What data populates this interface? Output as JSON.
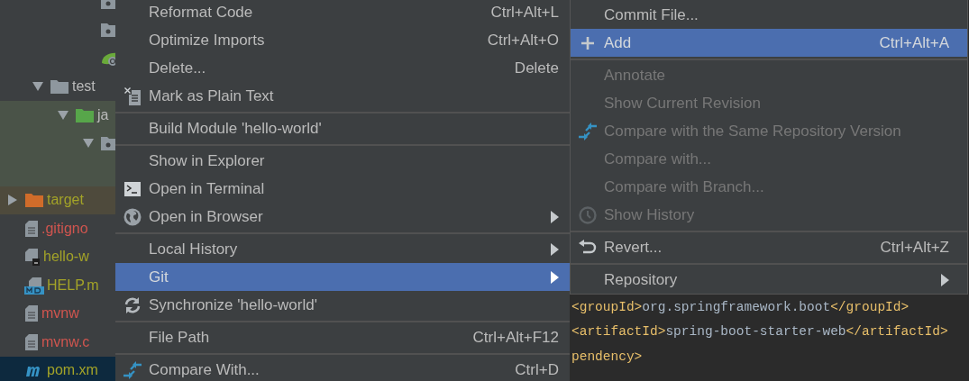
{
  "project_tree": {
    "continued_items": [
      {
        "kind": "package",
        "selected": false
      },
      {
        "kind": "package",
        "selected": false
      },
      {
        "kind": "spring-boot",
        "selected": false
      }
    ],
    "src_items": [
      {
        "kind": "folder",
        "label": "test",
        "color": "#bbbbbb",
        "expanded": true,
        "selected": false,
        "children": [
          {
            "kind": "source-folder",
            "label": "ja",
            "color": "#bbbbbb",
            "expanded": true,
            "selected": false,
            "children": [
              {
                "kind": "package",
                "expanded": true,
                "selected": false
              }
            ]
          }
        ]
      }
    ],
    "items": [
      {
        "kind": "excluded-folder",
        "label": "target",
        "color": "#a3a328",
        "expanded": false,
        "selected": false
      },
      {
        "kind": "text-file",
        "label": ".gitigno",
        "color": "#d0554f",
        "selected": false
      },
      {
        "kind": "script-file",
        "label": "hello-w",
        "color": "#a3a328",
        "selected": false
      },
      {
        "kind": "markdown-file",
        "label": "HELP.m",
        "color": "#a3a328",
        "selected": false
      },
      {
        "kind": "text-file",
        "label": "mvnw",
        "color": "#d0554f",
        "selected": false
      },
      {
        "kind": "text-file",
        "label": "mvnw.c",
        "color": "#d0554f",
        "selected": false
      },
      {
        "kind": "maven-file",
        "label": "pom.xm",
        "color": "#a3a328",
        "selected": true
      }
    ]
  },
  "context_menu": {
    "items": [
      {
        "kind": "item",
        "label": "Reformat Code",
        "shortcut": "Ctrl+Alt+L",
        "selected": false
      },
      {
        "kind": "item",
        "label": "Optimize Imports",
        "shortcut": "Ctrl+Alt+O",
        "selected": false
      },
      {
        "kind": "item",
        "label": "Delete...",
        "shortcut": "Delete",
        "selected": false
      },
      {
        "kind": "plaintext",
        "label": "Mark as Plain Text",
        "selected": false
      },
      {
        "kind": "separator"
      },
      {
        "kind": "item",
        "label": "Build Module 'hello-world'",
        "selected": false
      },
      {
        "kind": "separator"
      },
      {
        "kind": "item",
        "label": "Show in Explorer",
        "selected": false
      },
      {
        "kind": "terminal",
        "label": "Open in Terminal",
        "selected": false
      },
      {
        "kind": "globe",
        "label": "Open in Browser",
        "submenu": true,
        "selected": false
      },
      {
        "kind": "separator"
      },
      {
        "kind": "item",
        "label": "Local History",
        "submenu": true,
        "selected": false
      },
      {
        "kind": "item",
        "label": "Git",
        "submenu": true,
        "selected": true
      },
      {
        "kind": "sync",
        "label": "Synchronize 'hello-world'",
        "selected": false
      },
      {
        "kind": "separator"
      },
      {
        "kind": "item",
        "label": "File Path",
        "shortcut": "Ctrl+Alt+F12",
        "selected": false
      },
      {
        "kind": "separator"
      },
      {
        "kind": "compare",
        "label": "Compare With...",
        "shortcut": "Ctrl+D",
        "selected": false
      }
    ]
  },
  "git_submenu": {
    "items": [
      {
        "kind": "item",
        "label": "Commit File...",
        "disabled": false,
        "selected": false
      },
      {
        "kind": "plus",
        "label": "Add",
        "shortcut": "Ctrl+Alt+A",
        "disabled": false,
        "selected": true
      },
      {
        "kind": "separator"
      },
      {
        "kind": "item",
        "label": "Annotate",
        "disabled": true,
        "selected": false
      },
      {
        "kind": "item",
        "label": "Show Current Revision",
        "disabled": true,
        "selected": false
      },
      {
        "kind": "compare",
        "label": "Compare with the Same Repository Version",
        "disabled": true,
        "selected": false
      },
      {
        "kind": "item",
        "label": "Compare with...",
        "disabled": true,
        "selected": false
      },
      {
        "kind": "item",
        "label": "Compare with Branch...",
        "disabled": true,
        "selected": false
      },
      {
        "kind": "clock",
        "label": "Show History",
        "disabled": true,
        "selected": false
      },
      {
        "kind": "separator"
      },
      {
        "kind": "revert",
        "label": "Revert...",
        "shortcut": "Ctrl+Alt+Z",
        "disabled": false,
        "selected": false
      },
      {
        "kind": "separator"
      },
      {
        "kind": "item",
        "label": "Repository",
        "submenu": true,
        "disabled": false,
        "selected": false
      }
    ]
  },
  "editor": {
    "lines": [
      [
        {
          "kind": "tag",
          "text": "<groupId>"
        },
        {
          "kind": "text",
          "text": "org.springframework.boot"
        },
        {
          "kind": "tag",
          "text": "</groupId>"
        }
      ],
      [
        {
          "kind": "tag",
          "text": "<artifactId>"
        },
        {
          "kind": "text",
          "text": "spring-boot-starter-web"
        },
        {
          "kind": "tag",
          "text": "</artifactId>"
        }
      ],
      [
        {
          "kind": "tag",
          "text": "pendency>"
        }
      ]
    ]
  }
}
